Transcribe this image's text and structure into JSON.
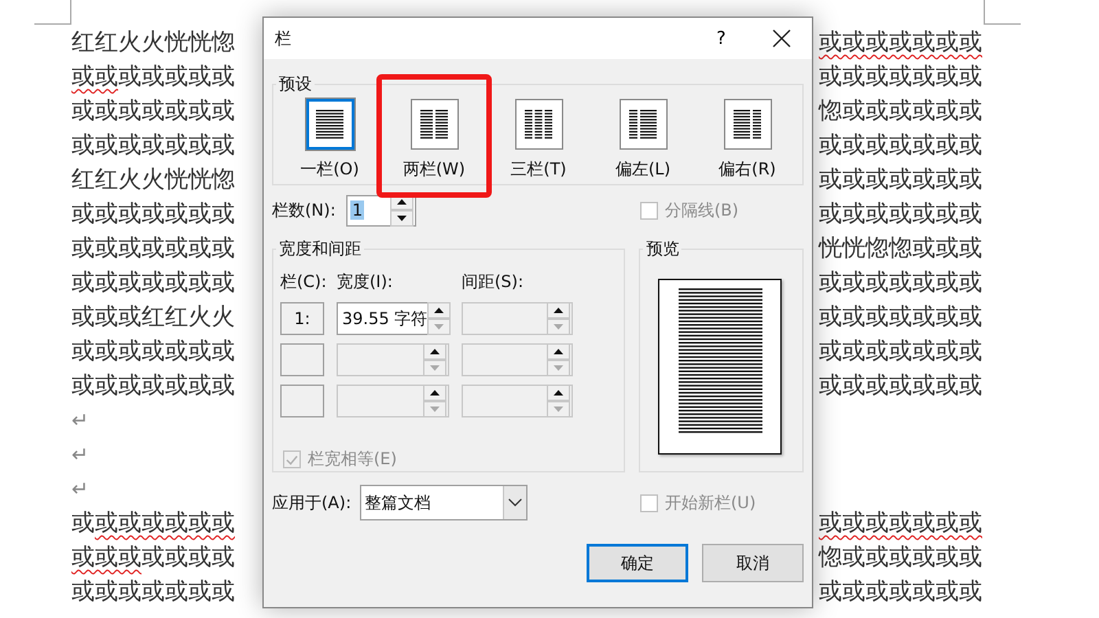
{
  "document": {
    "lines": [
      {
        "kind": "text",
        "left": [
          {
            "text": "红红火火恍恍惚",
            "misspelled": false
          }
        ],
        "right": [
          {
            "text": "或或或或或或或",
            "misspelled": true
          }
        ]
      },
      {
        "kind": "text",
        "left": [
          {
            "text": "或或",
            "misspelled": true
          },
          {
            "text": "或或或或或",
            "misspelled": false
          }
        ],
        "right": [
          {
            "text": "或或或或或或或",
            "misspelled": false
          }
        ]
      },
      {
        "kind": "text",
        "left": [
          {
            "text": "或或或或或或或",
            "misspelled": false
          }
        ],
        "right": [
          {
            "text": "惚或或或或或或",
            "misspelled": false
          }
        ]
      },
      {
        "kind": "text",
        "left": [
          {
            "text": "或或或或或或或",
            "misspelled": false
          }
        ],
        "right": [
          {
            "text": "或或或或或或或",
            "misspelled": false
          }
        ]
      },
      {
        "kind": "text",
        "left": [
          {
            "text": "红红火火恍恍惚",
            "misspelled": false
          }
        ],
        "right": [
          {
            "text": "或或或或或或或",
            "misspelled": false
          }
        ]
      },
      {
        "kind": "text",
        "left": [
          {
            "text": "或或或或或或或",
            "misspelled": false
          }
        ],
        "right": [
          {
            "text": "或或或或或或或",
            "misspelled": false
          }
        ]
      },
      {
        "kind": "text",
        "left": [
          {
            "text": "或或或或或或或",
            "misspelled": false
          }
        ],
        "right": [
          {
            "text": "恍恍惚惚或或或",
            "misspelled": false
          }
        ]
      },
      {
        "kind": "text",
        "left": [
          {
            "text": "或或或或或或或",
            "misspelled": false
          }
        ],
        "right": [
          {
            "text": "或或或或或或或",
            "misspelled": false
          }
        ]
      },
      {
        "kind": "text",
        "left": [
          {
            "text": "或或或红红火火",
            "misspelled": false
          }
        ],
        "right": [
          {
            "text": "或或或或或或或",
            "misspelled": false
          }
        ]
      },
      {
        "kind": "text",
        "left": [
          {
            "text": "或或或或或或或",
            "misspelled": false
          }
        ],
        "right": [
          {
            "text": "或或或或或或或",
            "misspelled": false
          }
        ]
      },
      {
        "kind": "text",
        "left": [
          {
            "text": "或或或或或或或",
            "misspelled": false
          }
        ],
        "right": [
          {
            "text": "或或或或或或或",
            "misspelled": false
          }
        ]
      },
      {
        "kind": "mark",
        "left": [
          {
            "text": "↵",
            "misspelled": false
          }
        ]
      },
      {
        "kind": "mark",
        "left": [
          {
            "text": "↵",
            "misspelled": false
          }
        ]
      },
      {
        "kind": "mark",
        "left": [
          {
            "text": "↵",
            "misspelled": false
          }
        ]
      },
      {
        "kind": "text",
        "left": [
          {
            "text": "或",
            "misspelled": false
          },
          {
            "text": "或或或或或或",
            "misspelled": true
          }
        ],
        "right": [
          {
            "text": "或或或或或或或",
            "misspelled": true
          }
        ]
      },
      {
        "kind": "text",
        "left": [
          {
            "text": "或或或",
            "misspelled": true
          },
          {
            "text": "或或或或",
            "misspelled": false
          }
        ],
        "right": [
          {
            "text": "惚或或或或或或",
            "misspelled": false
          }
        ]
      },
      {
        "kind": "text",
        "left": [
          {
            "text": "或或或或或或或",
            "misspelled": false
          }
        ],
        "right": [
          {
            "text": "或或或或或或或",
            "misspelled": false
          }
        ]
      }
    ]
  },
  "dialog": {
    "title": "栏",
    "help": "?",
    "presets": {
      "label": "预设",
      "items": [
        {
          "label": "一栏(O)",
          "kind": "one",
          "selected": true,
          "highlighted": false
        },
        {
          "label": "两栏(W)",
          "kind": "two",
          "selected": false,
          "highlighted": true
        },
        {
          "label": "三栏(T)",
          "kind": "three",
          "selected": false,
          "highlighted": false
        },
        {
          "label": "偏左(L)",
          "kind": "left",
          "selected": false,
          "highlighted": false
        },
        {
          "label": "偏右(R)",
          "kind": "right",
          "selected": false,
          "highlighted": false
        }
      ]
    },
    "column_count": {
      "label": "栏数(N):",
      "value": "1"
    },
    "separator": {
      "label": "分隔线(B)",
      "checked": false,
      "disabled": true
    },
    "width_spacing": {
      "label": "宽度和间距",
      "headers": [
        "栏(C):",
        "宽度(I):",
        "间距(S):"
      ],
      "rows": [
        {
          "number": "1:",
          "width": "39.55 字符",
          "disabled": false
        },
        {
          "disabled": true
        },
        {
          "disabled": true
        }
      ]
    },
    "equal_width": {
      "label": "栏宽相等(E)",
      "checked": true,
      "disabled": true
    },
    "preview": {
      "label": "预览"
    },
    "apply_to": {
      "label": "应用于(A):",
      "value": "整篇文档"
    },
    "new_column": {
      "label": "开始新栏(U)",
      "checked": false,
      "disabled": true
    },
    "buttons": [
      {
        "label": "确定",
        "default": true
      },
      {
        "label": "取消",
        "default": false
      }
    ]
  }
}
